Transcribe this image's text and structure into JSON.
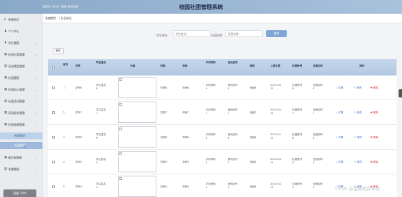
{
  "header": {
    "user_text": "管理员 admin 新端 退出登录",
    "title": "校园社团管理系统"
  },
  "sidebar": {
    "items": [
      {
        "icon": "⌂",
        "label": "系统首页",
        "chev": ""
      },
      {
        "icon": "♟",
        "label": "个人中心",
        "chev": "⌄"
      },
      {
        "icon": "♟",
        "label": "学生管理",
        "chev": "⌄"
      },
      {
        "icon": "▤",
        "label": "社团分类管理",
        "chev": "⌄"
      },
      {
        "icon": "▤",
        "label": "活动类型管理",
        "chev": "⌄"
      },
      {
        "icon": "▤",
        "label": "社团管理",
        "chev": "⌄"
      },
      {
        "icon": "▤",
        "label": "社团加入管理",
        "chev": "⌄"
      },
      {
        "icon": "▤",
        "label": "社团活动管理",
        "chev": "⌄"
      },
      {
        "icon": "▤",
        "label": "活动报名管理",
        "chev": "⌄"
      },
      {
        "icon": "▤",
        "label": "社团成绩管理",
        "chev": "⌃"
      }
    ],
    "subitems": [
      "社团成员",
      "社团成绩"
    ],
    "bottom_items": [
      {
        "icon": "▤",
        "label": "留言板管理",
        "chev": "⌄"
      },
      {
        "icon": "▤",
        "label": "系统管理",
        "chev": "⌄"
      }
    ],
    "storage": "容量: 50%"
  },
  "breadcrumb": {
    "home": "系统首页",
    "current": "社团成员"
  },
  "search": {
    "field1_label": "学生姓名",
    "field1_placeholder": "学生姓名",
    "field2_label": "社团名称",
    "field2_placeholder": "社团名称",
    "button": "查询"
  },
  "toolbar": {
    "delete_label": "删除"
  },
  "table": {
    "headers": [
      "索引",
      "学号",
      "学生姓名",
      "头像",
      "性别",
      "年龄",
      "手机号码",
      "身份证号",
      "班级",
      "入团日期",
      "社团账号",
      "社团名称",
      "操作"
    ],
    "rows": [
      {
        "index": "1",
        "xh": "学号8",
        "name": "学生姓名\n8",
        "sex": "性别8",
        "age": "年龄8",
        "phone": "手机号码\n8",
        "idc": "身份证号\n8",
        "cls": "班级8",
        "date": "2023-04-\n11",
        "acct": "社团账号\n8",
        "club": "社团名称\n8"
      },
      {
        "index": "2",
        "xh": "学号7",
        "name": "学生姓名\n7",
        "sex": "性别7",
        "age": "年龄7",
        "phone": "手机号码\n7",
        "idc": "身份证号\n7",
        "cls": "班级7",
        "date": "2023-04-\n11",
        "acct": "社团账号\n7",
        "club": "社团名称\n7"
      },
      {
        "index": "3",
        "xh": "学号6",
        "name": "学生姓名\n6",
        "sex": "性别6",
        "age": "年龄6",
        "phone": "手机号码\n6",
        "idc": "身份证号\n6",
        "cls": "班级6",
        "date": "2023-04-\n11",
        "acct": "社团账号\n6",
        "club": "社团名称\n6"
      },
      {
        "index": "4",
        "xh": "学号5",
        "name": "学生姓名\n5",
        "sex": "性别5",
        "age": "年龄5",
        "phone": "手机号码\n5",
        "idc": "身份证号\n5",
        "cls": "班级5",
        "date": "2023-04-\n11",
        "acct": "社团账号\n5",
        "club": "社团名称\n5"
      },
      {
        "index": "5",
        "xh": "学号4",
        "name": "学生姓名\n4",
        "sex": "性别4",
        "age": "年龄4",
        "phone": "手机号码\n4",
        "idc": "身份证号\n4",
        "cls": "班级4",
        "date": "2023-04-\n11",
        "acct": "社团账号\n4",
        "club": "社团名称\n4"
      }
    ],
    "actions": {
      "detail": "详情",
      "edit": "修改",
      "delete": "删除"
    }
  },
  "watermark": "CSDN @金新程序毕设",
  "colors": {
    "header": "#a9c2dc",
    "thead": "#b1c8e2",
    "detail": "#3a6fc4",
    "edit": "#3a6fc4",
    "delete": "#d9302c"
  }
}
